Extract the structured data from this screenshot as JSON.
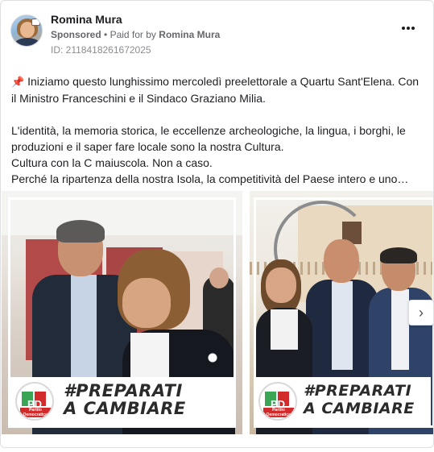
{
  "post": {
    "author": "Romina Mura",
    "sponsored": "Sponsored",
    "paid_for_by_prefix": "Paid for by",
    "paid_for_by_name": "Romina Mura",
    "separator": "•",
    "id_label": "ID: 2118418261672025",
    "more_icon": "more-options-icon"
  },
  "text": {
    "pin_icon": "📌",
    "line1": "Iniziamo questo lunghissimo mercoledì preelettorale a Quartu Sant'Elena. Con",
    "line2": "il Ministro Franceschini e il Sindaco Graziano Milia.",
    "line3": "L'identità, la memoria storica, le eccellenze archeologiche, la lingua, i borghi, le",
    "line4": "produzioni e il saper fare locale sono la nostra Cultura.",
    "line5": "Cultura con la C maiuscola. Non a caso.",
    "line6": "Perché la ripartenza della nostra Isola, la competitività del Paese intero e uno…"
  },
  "carousel": {
    "slides": [
      {
        "banner_line1": "#PREPARATI",
        "banner_line2": "A CAMBIARE",
        "logo_text": "PD",
        "logo_sub": "Partito Democratico"
      },
      {
        "banner_line1": "#PREPARATI",
        "banner_line2": "A CAMBIARE",
        "logo_text": "PD",
        "logo_sub": "Partito Democratico"
      }
    ],
    "next_glyph": "›"
  },
  "colors": {
    "text_primary": "#1c1e21",
    "text_secondary": "#65676b",
    "pd_green": "#3aa655",
    "pd_red": "#d22b2b"
  }
}
